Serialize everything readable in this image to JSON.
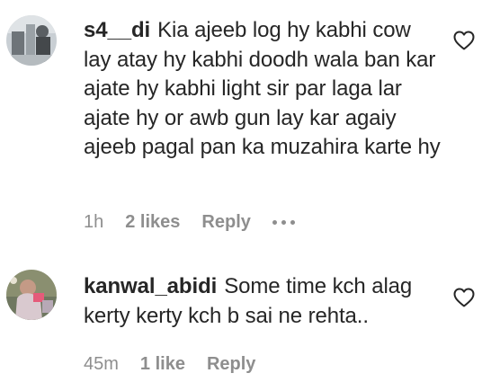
{
  "comments": [
    {
      "username": "s4__di",
      "text": "Kia ajeeb log hy kabhi cow lay atay hy kabhi doodh wala ban kar ajate hy kabhi light sir par laga lar ajate hy or awb gun lay kar agaiy ajeeb pagal pan ka muzahira karte hy",
      "time": "1h",
      "likes": "2 likes",
      "reply": "Reply",
      "more_icon": "more-horizontal-icon",
      "like_icon": "heart-outline-icon"
    },
    {
      "username": "kanwal_abidi",
      "text": "Some time kch alag kerty kerty kch b sai ne rehta..",
      "time": "45m",
      "likes": "1 like",
      "reply": "Reply",
      "like_icon": "heart-outline-icon"
    }
  ],
  "colors": {
    "text": "#262626",
    "meta": "#8e8e8e"
  }
}
